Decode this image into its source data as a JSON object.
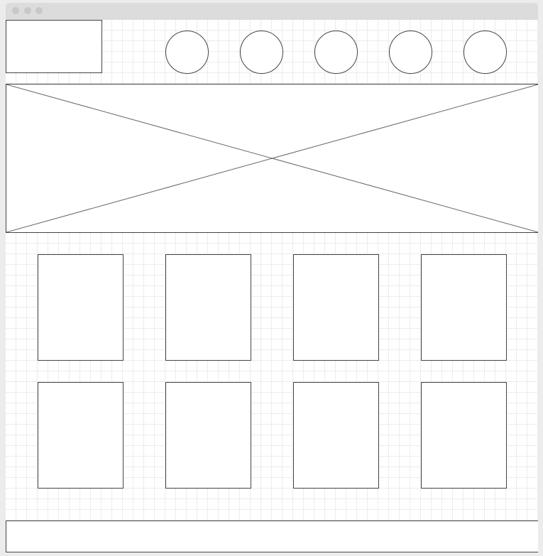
{
  "window": {
    "controls": [
      "close",
      "minimize",
      "maximize"
    ]
  },
  "header": {
    "logo": "logo-placeholder",
    "nav_items": 5
  },
  "hero": {
    "type": "image-placeholder"
  },
  "grid": {
    "rows": 2,
    "columns": 4
  },
  "footer": {
    "type": "footer-placeholder"
  },
  "colors": {
    "stroke": "#444444",
    "grid": "#ececec",
    "titlebar": "#dcdcdc"
  }
}
